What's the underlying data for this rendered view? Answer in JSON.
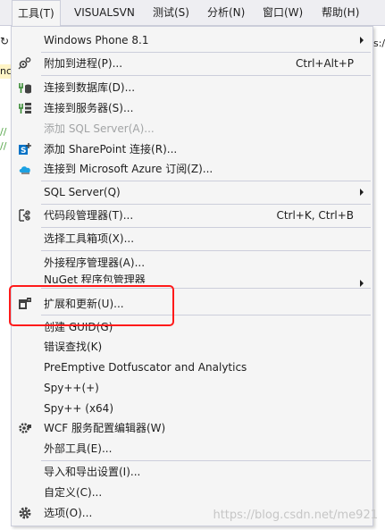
{
  "menubar": {
    "items": [
      "工具(T)",
      "VISUALSVN",
      "测试(S)",
      "分析(N)",
      "窗口(W)",
      "帮助(H)"
    ]
  },
  "background": {
    "left_fragment": "nc",
    "right_fragment": "s:/",
    "code_comment_1": "//",
    "code_comment_2": "//"
  },
  "menu": {
    "items": [
      {
        "label": "Windows Phone 8.1",
        "submenu": true
      },
      {
        "label": "附加到进程(P)...",
        "shortcut": "Ctrl+Alt+P",
        "icon": "attach-process-icon"
      },
      {
        "label": "连接到数据库(D)...",
        "icon": "connect-database-icon"
      },
      {
        "label": "连接到服务器(S)...",
        "icon": "connect-server-icon"
      },
      {
        "label": "添加 SQL Server(A)...",
        "disabled": true
      },
      {
        "label": "添加 SharePoint 连接(R)...",
        "icon": "sharepoint-icon"
      },
      {
        "label": "连接到 Microsoft Azure 订阅(Z)...",
        "icon": "azure-cloud-icon"
      },
      {
        "label": "SQL Server(Q)",
        "submenu": true
      },
      {
        "label": "代码段管理器(T)...",
        "shortcut": "Ctrl+K, Ctrl+B",
        "icon": "snippet-icon"
      },
      {
        "label": "选择工具箱项(X)..."
      },
      {
        "label": "外接程序管理器(A)..."
      },
      {
        "label": "NuGet 程序包管理器",
        "submenu": true
      },
      {
        "label": "扩展和更新(U)...",
        "icon": "extensions-icon"
      },
      {
        "label": "创建 GUID(G)"
      },
      {
        "label": "错误查找(K)"
      },
      {
        "label": "PreEmptive Dotfuscator and Analytics"
      },
      {
        "label": "Spy++(+)"
      },
      {
        "label": "Spy++ (x64)"
      },
      {
        "label": "WCF 服务配置编辑器(W)",
        "icon": "wcf-config-icon"
      },
      {
        "label": "外部工具(E)..."
      },
      {
        "label": "导入和导出设置(I)..."
      },
      {
        "label": "自定义(C)..."
      },
      {
        "label": "选项(O)...",
        "icon": "gear-icon"
      }
    ]
  },
  "watermark": "https://blog.csdn.net/me921",
  "colors": {
    "highlight": "#ff1a1a",
    "menu_bg": "#f5f5f5",
    "separator": "#cccedb",
    "azure": "#1ba1e2"
  }
}
